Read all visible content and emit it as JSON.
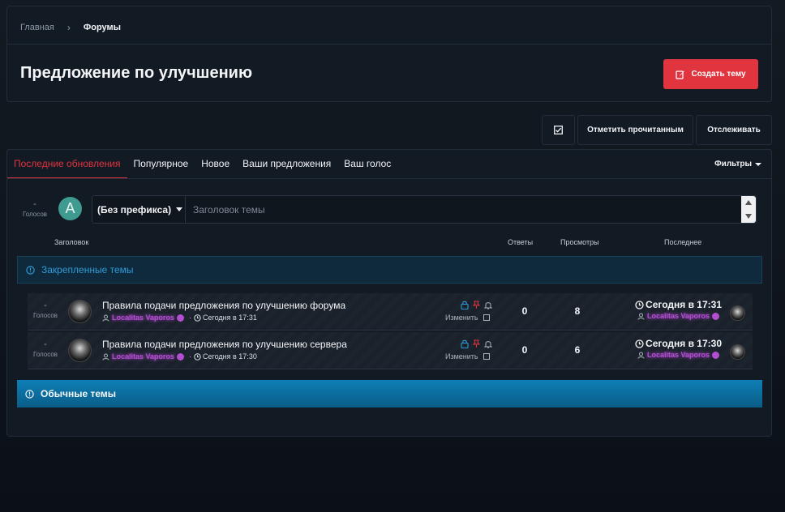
{
  "breadcrumb": {
    "home": "Главная",
    "separator": "›",
    "current": "Форумы"
  },
  "page": {
    "title": "Предложение по улучшению",
    "create_button": "Создать тему"
  },
  "actions": {
    "mark_read": "Отметить прочитанным",
    "watch": "Отслеживать"
  },
  "tabs": [
    {
      "label": "Последние обновления",
      "active": true
    },
    {
      "label": "Популярное",
      "active": false
    },
    {
      "label": "Новое",
      "active": false
    },
    {
      "label": "Ваши предложения",
      "active": false
    },
    {
      "label": "Ваш голос",
      "active": false
    }
  ],
  "filters_label": "Фильтры",
  "new_thread": {
    "votes_dash": "-",
    "votes_label": "Голосов",
    "avatar_letter": "A",
    "prefix": "(Без префикса)",
    "placeholder": "Заголовок темы"
  },
  "columns": {
    "title": "Заголовок",
    "replies": "Ответы",
    "views": "Просмотры",
    "last": "Последнее"
  },
  "sections": {
    "pinned": "Закрепленные темы",
    "normal": "Обычные темы"
  },
  "threads": [
    {
      "votes_dash": "-",
      "votes_label": "Голосов",
      "title": "Правила подачи предложения по улучшению форума",
      "author": "Localitas Vaporos",
      "date": "Сегодня в 17:31",
      "edit_label": "Изменить",
      "replies": "0",
      "views": "8",
      "last_date": "Сегодня в 17:31",
      "last_author": "Localitas Vaporos"
    },
    {
      "votes_dash": "-",
      "votes_label": "Голосов",
      "title": "Правила подачи предложения по улучшению сервера",
      "author": "Localitas Vaporos",
      "date": "Сегодня в 17:30",
      "edit_label": "Изменить",
      "replies": "0",
      "views": "6",
      "last_date": "Сегодня в 17:30",
      "last_author": "Localitas Vaporos"
    }
  ],
  "colors": {
    "accent_red": "#e0343f",
    "pinned_blue": "#2f9bd8",
    "author_purple": "#b44ed0",
    "normal_bar": "#0e7fb5"
  },
  "icons": [
    "edit-icon",
    "checkbox-icon",
    "caret-down-icon",
    "info-icon",
    "user-icon",
    "clock-icon",
    "lock-icon",
    "pin-icon",
    "bell-icon",
    "verified-badge-icon"
  ]
}
